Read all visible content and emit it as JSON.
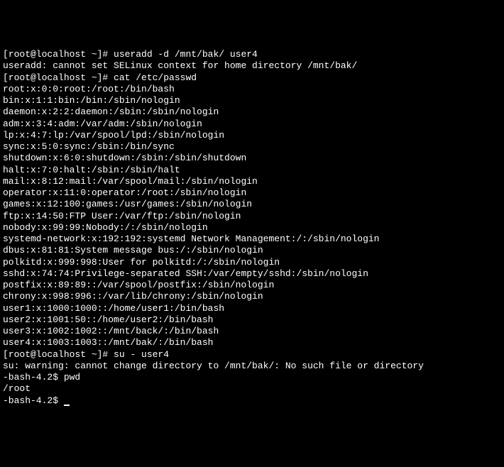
{
  "terminal": {
    "lines": [
      "[root@localhost ~]# useradd -d /mnt/bak/ user4",
      "useradd: cannot set SELinux context for home directory /mnt/bak/",
      "[root@localhost ~]# cat /etc/passwd",
      "root:x:0:0:root:/root:/bin/bash",
      "bin:x:1:1:bin:/bin:/sbin/nologin",
      "daemon:x:2:2:daemon:/sbin:/sbin/nologin",
      "adm:x:3:4:adm:/var/adm:/sbin/nologin",
      "lp:x:4:7:lp:/var/spool/lpd:/sbin/nologin",
      "sync:x:5:0:sync:/sbin:/bin/sync",
      "shutdown:x:6:0:shutdown:/sbin:/sbin/shutdown",
      "halt:x:7:0:halt:/sbin:/sbin/halt",
      "mail:x:8:12:mail:/var/spool/mail:/sbin/nologin",
      "operator:x:11:0:operator:/root:/sbin/nologin",
      "games:x:12:100:games:/usr/games:/sbin/nologin",
      "ftp:x:14:50:FTP User:/var/ftp:/sbin/nologin",
      "nobody:x:99:99:Nobody:/:/sbin/nologin",
      "systemd-network:x:192:192:systemd Network Management:/:/sbin/nologin",
      "dbus:x:81:81:System message bus:/:/sbin/nologin",
      "polkitd:x:999:998:User for polkitd:/:/sbin/nologin",
      "sshd:x:74:74:Privilege-separated SSH:/var/empty/sshd:/sbin/nologin",
      "postfix:x:89:89::/var/spool/postfix:/sbin/nologin",
      "chrony:x:998:996::/var/lib/chrony:/sbin/nologin",
      "user1:x:1000:1000::/home/user1:/bin/bash",
      "user2:x:1001:50::/home/user2:/bin/bash",
      "user3:x:1002:1002::/mnt/back/:/bin/bash",
      "user4:x:1003:1003::/mnt/bak/:/bin/bash",
      "[root@localhost ~]# su - user4",
      "su: warning: cannot change directory to /mnt/bak/: No such file or directory",
      "-bash-4.2$ pwd",
      "/root",
      "-bash-4.2$ "
    ]
  }
}
